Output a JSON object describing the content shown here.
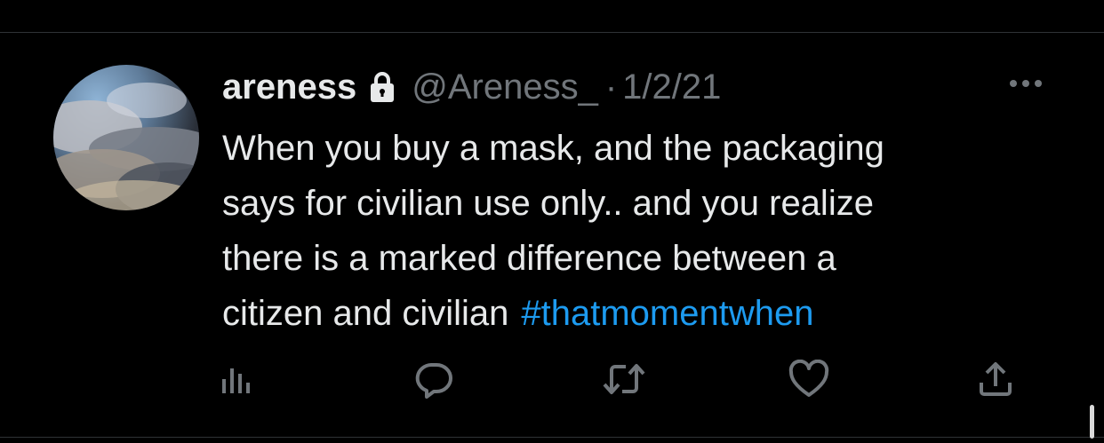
{
  "tweet": {
    "author_name": "areness",
    "handle": "@Areness_",
    "separator": "·",
    "date": "1/2/21",
    "text_lines": [
      "When you buy a mask, and the packaging",
      "says for civilian use only.. and you realize",
      "there is a marked difference between a",
      "citizen and civilian"
    ],
    "hashtag": "#thatmomentwhen"
  },
  "icons": {
    "lock": "lock-icon",
    "more": "more-icon",
    "analytics": "analytics-icon",
    "reply": "reply-icon",
    "retweet": "retweet-icon",
    "like": "like-icon",
    "share": "share-icon"
  },
  "colors": {
    "background": "#000000",
    "text_primary": "#e7e9ea",
    "text_secondary": "#71767b",
    "link": "#1d9bf0",
    "divider": "#2f3336"
  }
}
